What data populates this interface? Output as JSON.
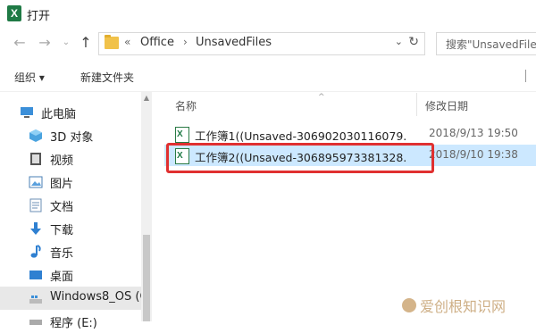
{
  "window": {
    "title": "打开",
    "app_icon": "excel-icon"
  },
  "address": {
    "crumb_prefix": "«",
    "crumbs": [
      "Office",
      "UnsavedFiles"
    ],
    "separator": "›",
    "search_placeholder": "搜索\"UnsavedFiles\""
  },
  "toolbar": {
    "organize": "组织 ▾",
    "new_folder": "新建文件夹"
  },
  "sidebar": {
    "items": [
      {
        "label": "此电脑",
        "icon": "computer-icon"
      },
      {
        "label": "3D 对象",
        "icon": "cube-icon"
      },
      {
        "label": "视频",
        "icon": "video-icon"
      },
      {
        "label": "图片",
        "icon": "picture-icon"
      },
      {
        "label": "文档",
        "icon": "document-icon"
      },
      {
        "label": "下载",
        "icon": "download-icon"
      },
      {
        "label": "音乐",
        "icon": "music-icon"
      },
      {
        "label": "桌面",
        "icon": "desktop-icon"
      },
      {
        "label": "Windows8_OS (C",
        "icon": "drive-icon"
      },
      {
        "label": "程序 (E:)",
        "icon": "drive-icon"
      }
    ]
  },
  "list": {
    "columns": {
      "name": "名称",
      "modified": "修改日期"
    },
    "files": [
      {
        "name": "工作簿1((Unsaved-306902030116079...",
        "date": "2018/9/13 19:50"
      },
      {
        "name": "工作簿2((Unsaved-306895973381328...",
        "date": "2018/9/10 19:38"
      }
    ]
  },
  "watermark": "爱创根知识网",
  "colors": {
    "selection": "#cce8ff",
    "highlight": "#e03030",
    "excel": "#1f7a45"
  }
}
